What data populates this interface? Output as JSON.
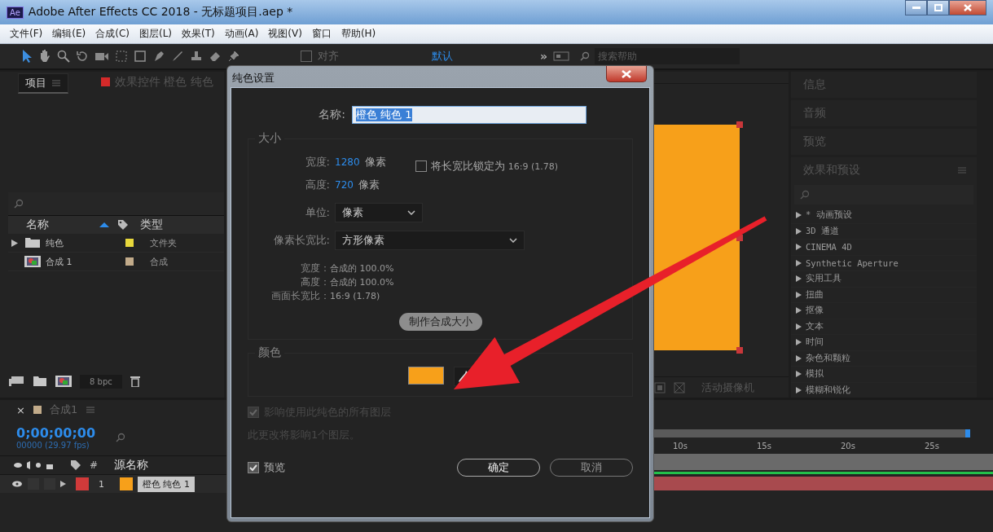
{
  "window": {
    "app_badge": "Ae",
    "title": "Adobe After Effects CC 2018 - 无标题项目.aep *"
  },
  "menu": [
    "文件(F)",
    "编辑(E)",
    "合成(C)",
    "图层(L)",
    "效果(T)",
    "动画(A)",
    "视图(V)",
    "窗口",
    "帮助(H)"
  ],
  "toolbar": {
    "snap": {
      "label": "对齐",
      "checked": false
    },
    "workspace": "默认",
    "more": "»",
    "search": {
      "placeholder": "搜索帮助"
    }
  },
  "project_panel": {
    "tabs": [
      {
        "label": "项目",
        "selected": true
      },
      {
        "label": "效果控件 橙色 纯色",
        "selected": false,
        "color": "#d42a2a"
      }
    ],
    "columns": [
      "名称",
      "类型"
    ],
    "items": [
      {
        "kind": "folder",
        "name": "纯色",
        "type": "文件夹",
        "color": "#e8d83c"
      },
      {
        "kind": "comp",
        "name": "合成 1",
        "type": "合成",
        "color": "#c2ab8a"
      }
    ],
    "bit_depth": "8 bpc"
  },
  "viewer": {
    "camera": "活动摄像机"
  },
  "info_panels": [
    "信息",
    "音频",
    "预览"
  ],
  "effects_panel": {
    "title": "效果和预设",
    "items": [
      "* 动画预设",
      "3D 通道",
      "CINEMA 4D",
      "Synthetic Aperture",
      "实用工具",
      "扭曲",
      "抠像",
      "文本",
      "时间",
      "杂色和颗粒",
      "模拟",
      "模糊和锐化"
    ]
  },
  "timeline": {
    "close": "×",
    "tab": "合成1",
    "timecode": "0;00;00;00",
    "fps": "00000 (29.97 fps)",
    "columns": [
      "#",
      "源名称"
    ],
    "layers": [
      {
        "number": "1",
        "name": "橙色 纯色 1",
        "color": "#d13a3a",
        "switches": [
          {
            "on": false
          },
          {
            "on": false
          }
        ]
      }
    ],
    "ruler": [
      "10s",
      "15s",
      "20s",
      "25s"
    ]
  },
  "dialog": {
    "title": "纯色设置",
    "name_label": "名称:",
    "name_value": "橙色 纯色 1",
    "size_section": "大小",
    "width": {
      "label": "宽度:",
      "value": "1280",
      "unit": "像素"
    },
    "height": {
      "label": "高度:",
      "value": "720",
      "unit": "像素"
    },
    "lock_ratio": {
      "label": "将长宽比锁定为",
      "ratio": "16:9 (1.78)",
      "checked": false
    },
    "units": {
      "label": "单位:",
      "value": "像素"
    },
    "pixel_aspect": {
      "label": "像素长宽比:",
      "value": "方形像素"
    },
    "info": [
      {
        "label": "宽度：",
        "value": "合成的 100.0%"
      },
      {
        "label": "高度：",
        "value": "合成的 100.0%"
      },
      {
        "label": "画面长宽比：",
        "value": "16:9 (1.78)"
      }
    ],
    "make_comp_size": "制作合成大小",
    "color_section": "颜色",
    "color": "#f7a01a",
    "affect_all": {
      "label": "影响使用此纯色的所有图层",
      "checked": true,
      "disabled": true
    },
    "note": "此更改将影响1个图层。",
    "preview": {
      "label": "预览",
      "checked": true
    },
    "ok": "确定",
    "cancel": "取消"
  }
}
